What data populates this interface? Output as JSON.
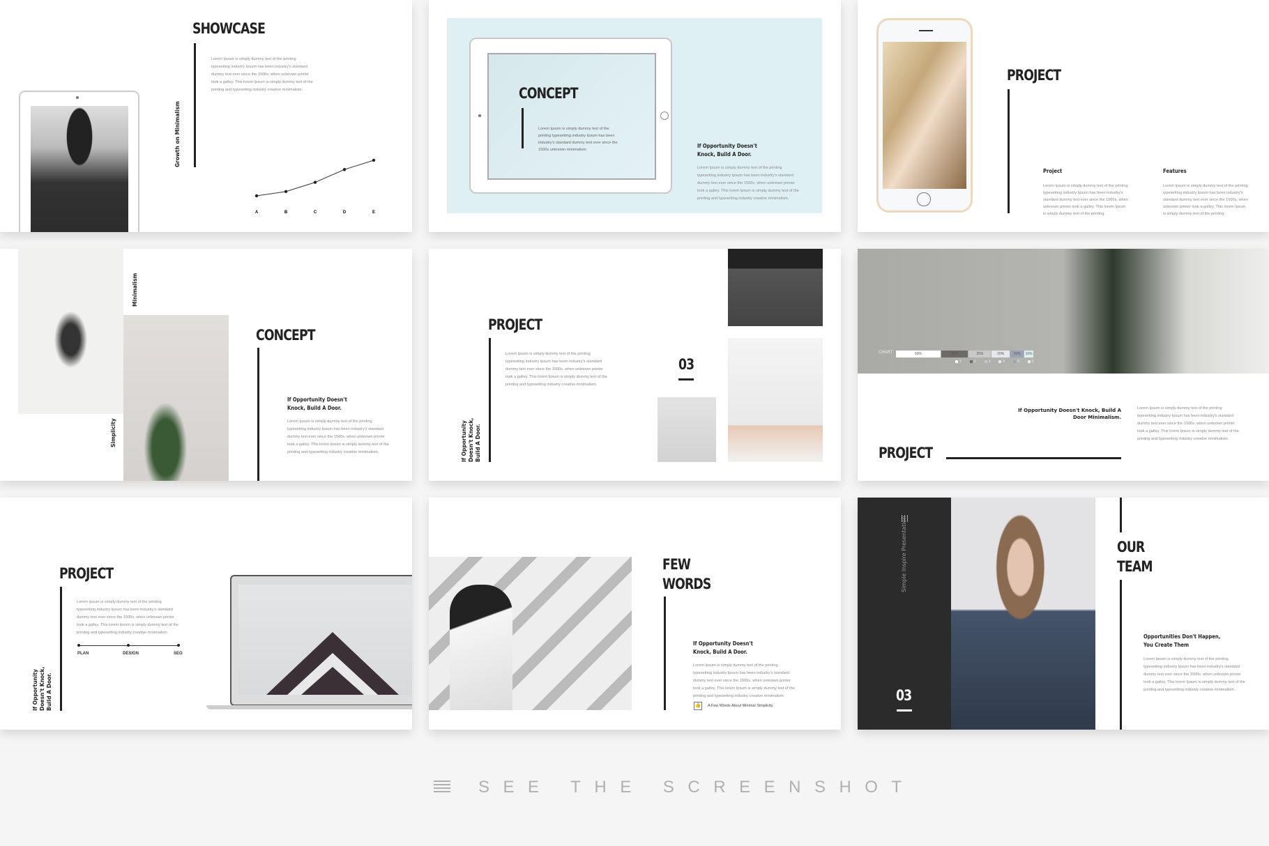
{
  "lorem": "Lorem Ipsum is simply dummy text of the printing typesetting industry Ipsum has been industry's standard dummy text ever since the 1500s, when unknown printer took a galley. This lorem Ipsum is simply dummy text of the printing and typesetting industry creative minimalism.",
  "lorem_short": "Lorem Ipsum is simply dummy text of the printing typesetting industry Ipsum has been industry's standard dummy text ever since the 1500s unknown minimalism.",
  "lorem_col": "Lorem Ipsum is simply dummy text of the printing typesetting industry Ipsum has been industry's standard dummy text ever since the 1500s, when unknown printer took a galley. This lorem Ipsum is simply dummy text of the printing.",
  "quote": "If Opportunity Doesn't Knock, Build A Door.",
  "slides": {
    "showcase": {
      "title": "SHOWCASE",
      "side_label": "Growth on Minimalism"
    },
    "concept_tablet": {
      "title": "CONCEPT"
    },
    "project_phone": {
      "title": "PROJECT",
      "col1_title": "Project",
      "col2_title": "Features"
    },
    "concept_images": {
      "title": "CONCEPT",
      "label_top": "Minimalism",
      "label_bottom": "Simplicity"
    },
    "project_gallery": {
      "title": "PROJECT",
      "number": "03"
    },
    "project_chart": {
      "title": "PROJECT",
      "chart_label": "CHART",
      "quote": "If Opportunity Doesn't Knock, Build A Door Minimalism."
    },
    "project_laptop": {
      "title": "PROJECT",
      "timeline": [
        "PLAN",
        "DESIGN",
        "SEO"
      ]
    },
    "few_words": {
      "title_line1": "FEW",
      "title_line2": "WORDS",
      "caption": "A Few Words About Minimal Simplicity."
    },
    "our_team": {
      "title_line1": "OUR",
      "title_line2": "TEAM",
      "side_text": "Simple Inspire Presentation",
      "number": "03",
      "heading": "Opportunities Don't Happen, You Create Them"
    }
  },
  "footer": {
    "label": "SEE THE SCREENSHOT",
    "icon": "hamburger-menu-icon"
  },
  "colors": {
    "dark": "#222222",
    "light_blue": "#dff0f4",
    "footer_text": "#b0b0b0",
    "background": "#f5f5f5"
  },
  "chart_data": [
    {
      "type": "line",
      "categories": [
        "A",
        "B",
        "C",
        "D",
        "E"
      ],
      "values": [
        0,
        12,
        38,
        74,
        100
      ]
    },
    {
      "type": "bar",
      "title": "CHART",
      "categories": [
        "1",
        "2",
        "3",
        "4",
        "5",
        "6"
      ],
      "values": [
        50,
        30,
        25,
        20,
        15,
        10
      ],
      "labels": [
        "50%",
        "30%",
        "25%",
        "20%",
        "15%",
        "10%"
      ],
      "colors": [
        "#ffffff",
        "#6e6a6a",
        "#c9c9c9",
        "#e6e6ee",
        "#9ca3b4",
        "#dff0f4"
      ]
    }
  ]
}
